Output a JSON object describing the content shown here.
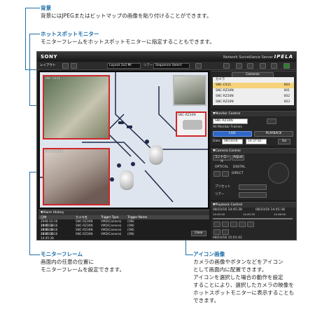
{
  "annotations": {
    "background": {
      "title": "背景",
      "body": [
        "背景にはJPEGまたはビットマップの画像を貼り付けることができます。"
      ]
    },
    "hotspot": {
      "title": "ホットスポットモニター",
      "body": [
        "モニターフレームをホットスポットモニターに指定することもできます。"
      ]
    },
    "monitor_frame": {
      "title": "モニターフレーム",
      "body": [
        "画面内の任意の位置に",
        "モニターフレームを設定できます。"
      ]
    },
    "icon_image": {
      "title": "アイコン画像",
      "body": [
        "カメラの画像やボタンなどをアイコン",
        "として画面内に配置できます。",
        "アイコンを選択した場合の動作を設定",
        "することにより、選択したカメラの映像を",
        "ホットスポットモニターに表示することも",
        "できます。"
      ]
    }
  },
  "app": {
    "brand": "SONY",
    "product_small": "Network Surveillance Server",
    "product_big": "IPELA",
    "toolbar": {
      "layout_label": "レイアウト",
      "layout_select": "Layout 2x2 Ml",
      "tour_label": "ツアー",
      "sequence_select": "Sequence Select"
    }
  },
  "monitor": {
    "frame_labels": [
      "SNC-CS11",
      "SNC-RZ30N",
      "SNC-RZ30N"
    ]
  },
  "alarm_history": {
    "title": "▼Alarm History",
    "headers": [
      "日時",
      "カメラ名",
      "Trigger Type",
      "Trigger Name"
    ],
    "rows": [
      [
        "2008-10-16 14:45:38",
        "SNC-RZ30N",
        "VMD(Camera)",
        "(ON)"
      ],
      [
        "2008-10-16 14:45:38",
        "SNC-RZ30N",
        "VMD(Camera)",
        "(ON)"
      ],
      [
        "2008-10-16 14:45:38",
        "SNC-RZ30N",
        "VMD(Camera)",
        "(ON)"
      ],
      [
        "2008-10-16 14:45:38",
        "SNC-RZ30N",
        "VMD(Camera)",
        "(ON)"
      ]
    ],
    "clear": "Clear"
  },
  "right": {
    "cameras_select": "Cameras",
    "tree": [
      {
        "name": "カメラ",
        "id": ""
      },
      {
        "name": "SNC-CS11",
        "id": "004"
      },
      {
        "name": "SNC-RZ30N",
        "id": "001"
      },
      {
        "name": "SNC-RZ30N",
        "id": "002"
      },
      {
        "name": "SNC-RZ30N",
        "id": "003"
      }
    ],
    "monitor_control": "▼Monitor Control",
    "monitor_camera": "SNC-RZ30N",
    "all_monitor_frames": "All Monitor Frames",
    "live": "LIVE",
    "playback": "PLAYBACK",
    "date_label": "Date",
    "date": "08/10/16",
    "time": "14:37:42",
    "go": "Go",
    "camera_control": "▼Camera Control",
    "cc_tab1": "コントロール",
    "cc_tab2": "Adjust",
    "optical": "OPTICAL",
    "digital": "DIGITAL",
    "direct": "DIRECT",
    "preset": "プリセット",
    "tour": "ツアー",
    "playback_control": "▼Playback Control",
    "pb_date1": "08/10/16 14:45:38",
    "pb_date2": "08/10/16 14:45:38",
    "pb_times": [
      "14:45:00",
      "14:45:30",
      "14:46:00"
    ],
    "pb_status": "08/10/16 15:01:42"
  },
  "colors": {
    "accent": "#1f6fa8",
    "frame": "#d0262a",
    "live": "#2f66c8"
  }
}
